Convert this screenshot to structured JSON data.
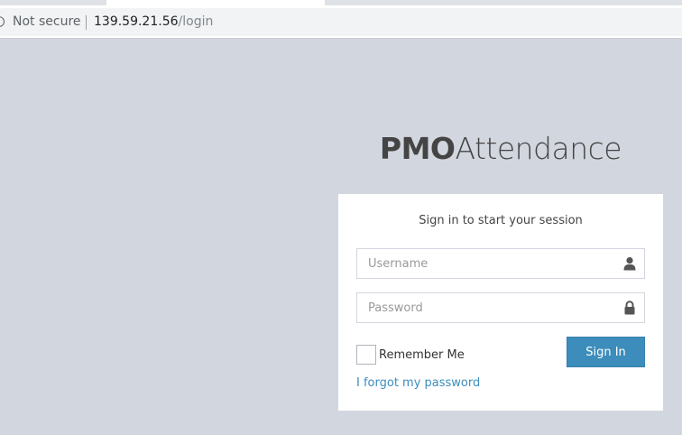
{
  "browser": {
    "security_label": "Not secure",
    "url_host": "139.59.21.56",
    "url_path": "/login"
  },
  "logo": {
    "bold": "PMO",
    "light": "Attendance"
  },
  "login": {
    "message": "Sign in to start your session",
    "username_placeholder": "Username",
    "password_placeholder": "Password",
    "remember_label": "Remember Me",
    "signin_label": "Sign In",
    "forgot_label": "I forgot my password"
  },
  "colors": {
    "background": "#d2d6de",
    "accent": "#3c8dbc"
  },
  "icons": {
    "username": "user-icon",
    "password": "lock-icon",
    "security": "info-icon"
  }
}
